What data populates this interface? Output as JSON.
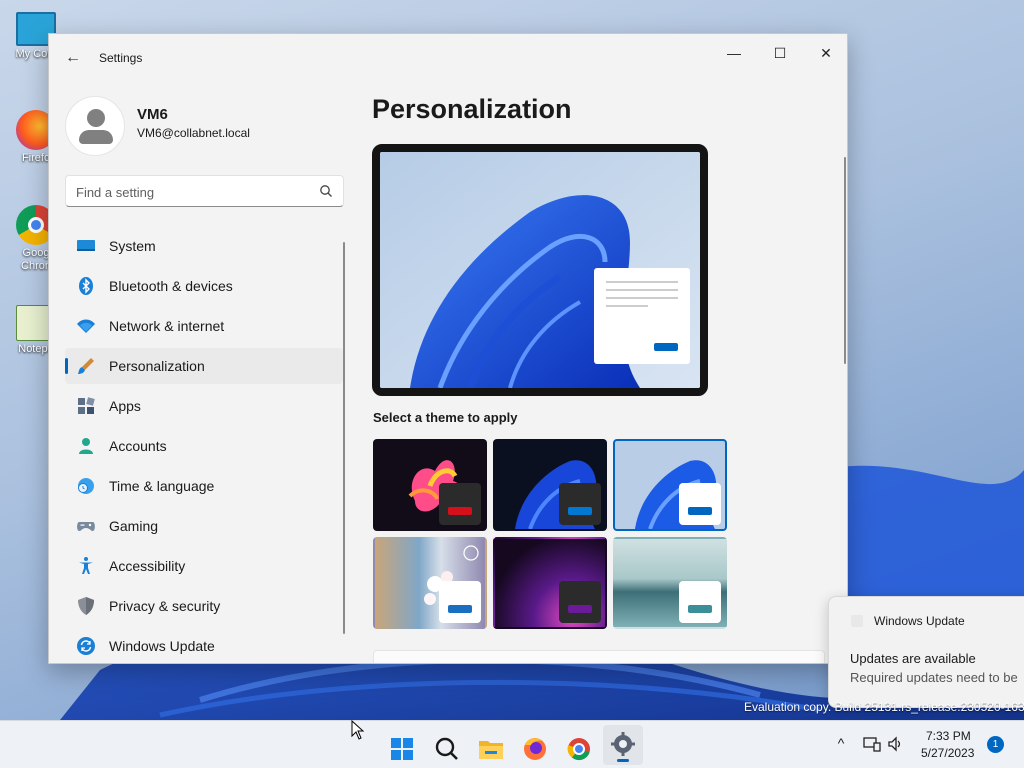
{
  "desktop": {
    "icons": [
      {
        "label": "My Com",
        "icon": "computer-icon"
      },
      {
        "label": "Firefo",
        "icon": "firefox-icon"
      },
      {
        "label": "Goog Chron",
        "icon": "chrome-icon"
      },
      {
        "label": "Notepa",
        "icon": "notepad-icon"
      }
    ],
    "watermark": "Evaluation copy. Build 25131.rs_release.230520-1632"
  },
  "window": {
    "title": "Settings",
    "controls": {
      "minimize": "—",
      "maximize": "☐",
      "close": "✕"
    },
    "back_glyph": "←"
  },
  "profile": {
    "name": "VM6",
    "email": "VM6@collabnet.local"
  },
  "search": {
    "placeholder": "Find a setting",
    "value": ""
  },
  "nav": {
    "items": [
      {
        "label": "System",
        "icon": "system-icon",
        "active": false
      },
      {
        "label": "Bluetooth & devices",
        "icon": "bluetooth-icon",
        "active": false
      },
      {
        "label": "Network & internet",
        "icon": "wifi-icon",
        "active": false
      },
      {
        "label": "Personalization",
        "icon": "brush-icon",
        "active": true
      },
      {
        "label": "Apps",
        "icon": "apps-icon",
        "active": false
      },
      {
        "label": "Accounts",
        "icon": "account-icon",
        "active": false
      },
      {
        "label": "Time & language",
        "icon": "globe-clock-icon",
        "active": false
      },
      {
        "label": "Gaming",
        "icon": "gamepad-icon",
        "active": false
      },
      {
        "label": "Accessibility",
        "icon": "accessibility-icon",
        "active": false
      },
      {
        "label": "Privacy & security",
        "icon": "shield-icon",
        "active": false
      },
      {
        "label": "Windows Update",
        "icon": "update-icon",
        "active": false
      }
    ]
  },
  "main": {
    "title": "Personalization",
    "theme_section_label": "Select a theme to apply",
    "themes": [
      {
        "name": "glow",
        "accent": "#d4101a",
        "selected": false
      },
      {
        "name": "windows-dark",
        "accent": "#0067c0",
        "selected": false
      },
      {
        "name": "windows-light",
        "accent": "#0067c0",
        "selected": true
      },
      {
        "name": "spotlight",
        "accent": "#1a6fc0",
        "selected": false
      },
      {
        "name": "sunrise",
        "accent": "#6b1a9a",
        "selected": false
      },
      {
        "name": "flow",
        "accent": "#3a8f98",
        "selected": false
      }
    ]
  },
  "notification": {
    "app": "Windows Update",
    "title": "Updates are available",
    "body": "Required updates need to be"
  },
  "taskbar": {
    "apps": [
      "start-icon",
      "search-icon",
      "file-explorer-icon",
      "firefox-icon",
      "chrome-icon",
      "settings-icon"
    ],
    "time": "7:33 PM",
    "date": "5/27/2023",
    "notification_count": "1",
    "tray_chevron": "^"
  },
  "colors": {
    "accent": "#0067c0",
    "window_bg": "#f3f3f3"
  }
}
